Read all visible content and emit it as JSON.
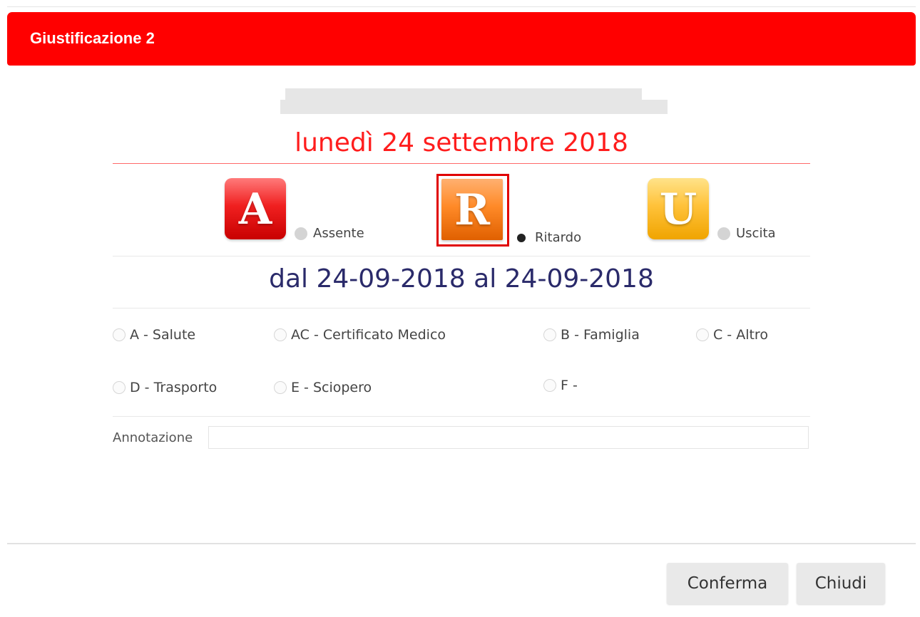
{
  "dialog": {
    "title": "Giustificazione 2"
  },
  "date_heading": "lunedì 24 settembre 2018",
  "types": [
    {
      "letter": "A",
      "label": "Assente",
      "selected": false,
      "color": "#e8161a"
    },
    {
      "letter": "R",
      "label": "Ritardo",
      "selected": true,
      "color": "#ff8a28"
    },
    {
      "letter": "U",
      "label": "Uscita",
      "selected": false,
      "color": "#ffc23a"
    }
  ],
  "range": "dal 24-09-2018 al 24-09-2018",
  "reasons": [
    {
      "label": "A - Salute"
    },
    {
      "label": "AC - Certificato Medico"
    },
    {
      "label": "B - Famiglia"
    },
    {
      "label": "C - Altro"
    },
    {
      "label": "D - Trasporto"
    },
    {
      "label": "E - Sciopero"
    },
    {
      "label": "F -"
    }
  ],
  "annotation": {
    "label": "Annotazione",
    "value": ""
  },
  "buttons": {
    "confirm": "Conferma",
    "close": "Chiudi"
  },
  "colors": {
    "header": "#ff0000",
    "date": "#ff1d1d",
    "range": "#2a2a6a"
  }
}
